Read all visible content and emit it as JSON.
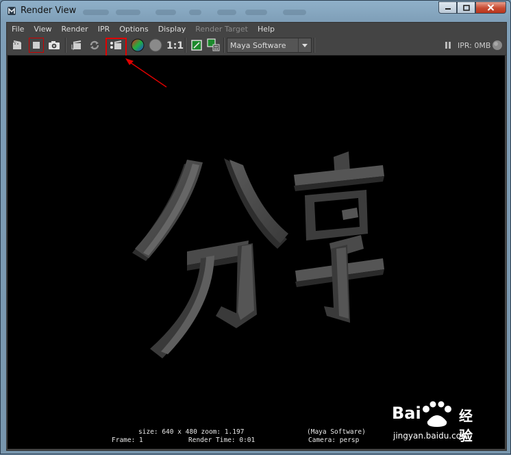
{
  "window": {
    "title": "Render View",
    "icon": "maya-app-icon"
  },
  "title_controls": {
    "minimize_icon": "minimize-icon",
    "maximize_icon": "maximize-icon",
    "close_icon": "close-icon"
  },
  "menu": [
    "File",
    "View",
    "Render",
    "IPR",
    "Options",
    "Display",
    "Render Target",
    "Help"
  ],
  "menu_disabled": [
    "Render Target"
  ],
  "toolbar": {
    "icons": [
      "redo-previous-render-icon",
      "render-region-icon",
      "snapshot-icon",
      "ipr-render-icon",
      "refresh-ipr-icon",
      "render-sequence-icon",
      "display-rgb-icon",
      "display-alpha-icon",
      "real-size-icon",
      "keep-image-icon",
      "remove-image-icon"
    ],
    "ratio_label": "1:1",
    "renderer": "Maya Software",
    "ipr_status": "IPR: 0MB",
    "highlighted": "render-sequence-icon",
    "highlight_color": "#e00000"
  },
  "viewport": {
    "info_line1_left": "size: 640 x 480 zoom: 1.197",
    "info_line1_right": "(Maya Software)",
    "info_line2_left": "Frame: 1",
    "info_line2_mid": "Render Time: 0:01",
    "info_line2_right": "Camera: persp",
    "render_text": "分享",
    "background": "#000000"
  },
  "watermark": {
    "brand": "Bai",
    "brand2": "经验",
    "url": "jingyan.baidu.com"
  }
}
